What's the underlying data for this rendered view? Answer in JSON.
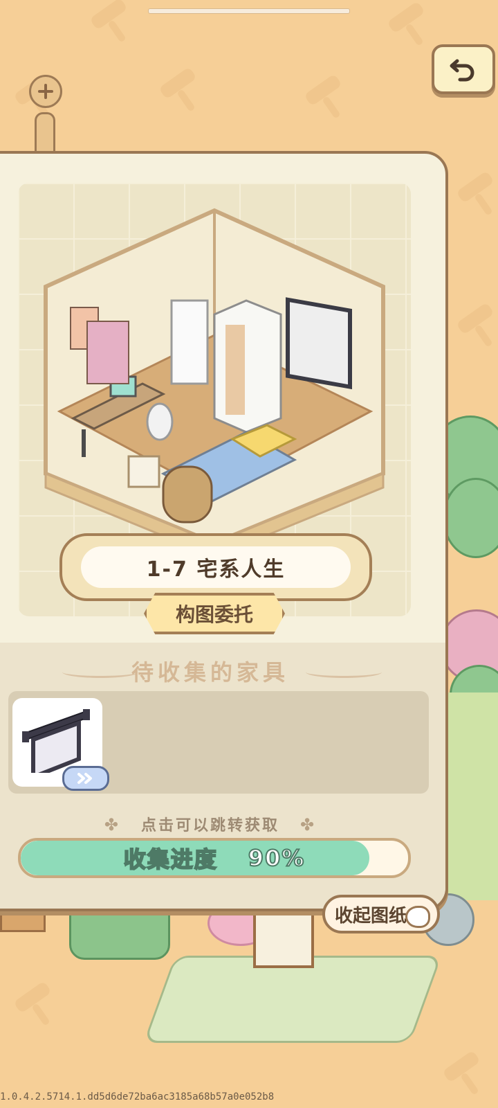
{
  "level": {
    "title": "1-7 宅系人生",
    "subtitle": "构图委托"
  },
  "collection": {
    "section_title": "待收集的家具",
    "items": [
      {
        "icon": "projector-screen-icon",
        "badge": "»"
      }
    ],
    "hint": "点击可以跳转获取",
    "progress_label": "收集进度",
    "progress_value": "90%",
    "progress_fraction": 0.9
  },
  "controls": {
    "collapse_label": "收起图纸"
  },
  "version": "1.0.4.2.5714.1.dd5d6de72ba6ac3185a68b57a0e052b8",
  "colors": {
    "background": "#f6cf97",
    "panel": "#f6f1dd",
    "border": "#9a7753",
    "progress": "#8edbb9"
  }
}
